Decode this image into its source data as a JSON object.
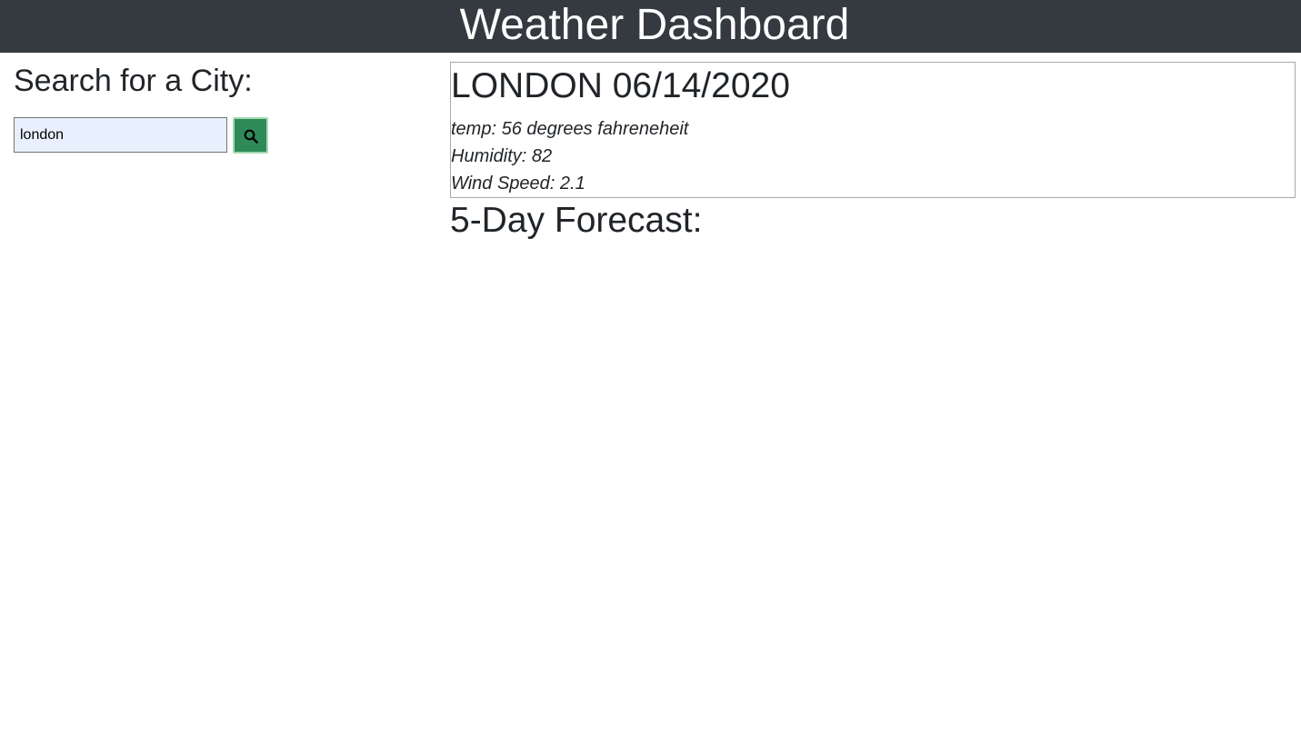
{
  "header": {
    "title": "Weather Dashboard",
    "background_color": "#343a40",
    "text_color": "#ffffff"
  },
  "search": {
    "heading": "Search for a City:",
    "input_value": "london",
    "button_icon": "search-icon",
    "button_color": "#2e8b57"
  },
  "current": {
    "city": "LONDON",
    "date": "06/14/2020",
    "temp_label": "temp:",
    "temp_value": "56",
    "temp_unit": "degrees fahreneheit",
    "humidity_label": "Humidity:",
    "humidity_value": "82",
    "wind_label": "Wind Speed:",
    "wind_value": "2.1"
  },
  "forecast": {
    "heading": "5-Day Forecast:"
  }
}
